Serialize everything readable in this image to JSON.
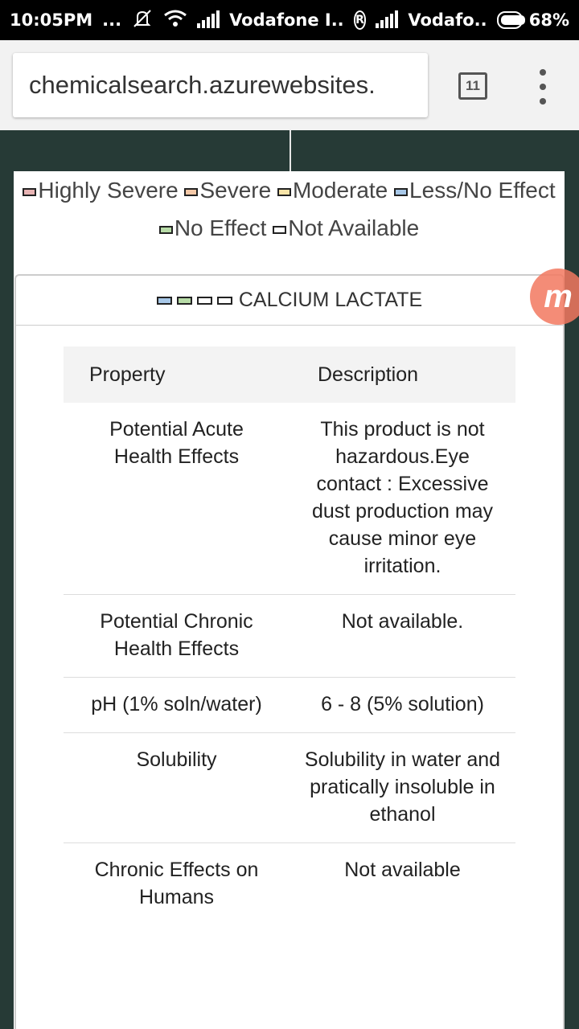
{
  "status_bar": {
    "time": "10:05PM",
    "dots": "...",
    "carrier1": "Vodafone I..",
    "carrier2": "Vodafo..",
    "roaming": "R",
    "battery": "68%"
  },
  "browser": {
    "url": "chemicalsearch.azurewebsites.",
    "tab_count": "11"
  },
  "legend": {
    "items": [
      {
        "label": "Highly Severe",
        "color": "#e8b4b4"
      },
      {
        "label": "Severe",
        "color": "#f5c9a8"
      },
      {
        "label": "Moderate",
        "color": "#f8e4a8"
      },
      {
        "label": "Less/No Effect",
        "color": "#a8c8e8"
      },
      {
        "label": "No Effect",
        "color": "#b8dca8"
      },
      {
        "label": "Not Available",
        "color": "#ffffff"
      }
    ]
  },
  "panel": {
    "title": "CALCIUM LACTATE",
    "swatch_colors": [
      "#a8c8e8",
      "#b8dca8",
      "#ffffff",
      "#ffffff"
    ]
  },
  "table": {
    "headers": [
      "Property",
      "Description"
    ],
    "rows": [
      {
        "property": "Potential Acute Health Effects",
        "description": "This product is not hazardous.Eye contact : Excessive dust production may cause minor eye irritation."
      },
      {
        "property": "Potential Chronic Health Effects",
        "description": "Not available."
      },
      {
        "property": "pH (1% soln/water)",
        "description": "6 - 8 (5% solution)"
      },
      {
        "property": "Solubility",
        "description": "Solubility in water and pratically insoluble in ethanol"
      },
      {
        "property": "Chronic Effects on Humans",
        "description": "Not available"
      }
    ]
  },
  "badge": {
    "letter": "m"
  }
}
